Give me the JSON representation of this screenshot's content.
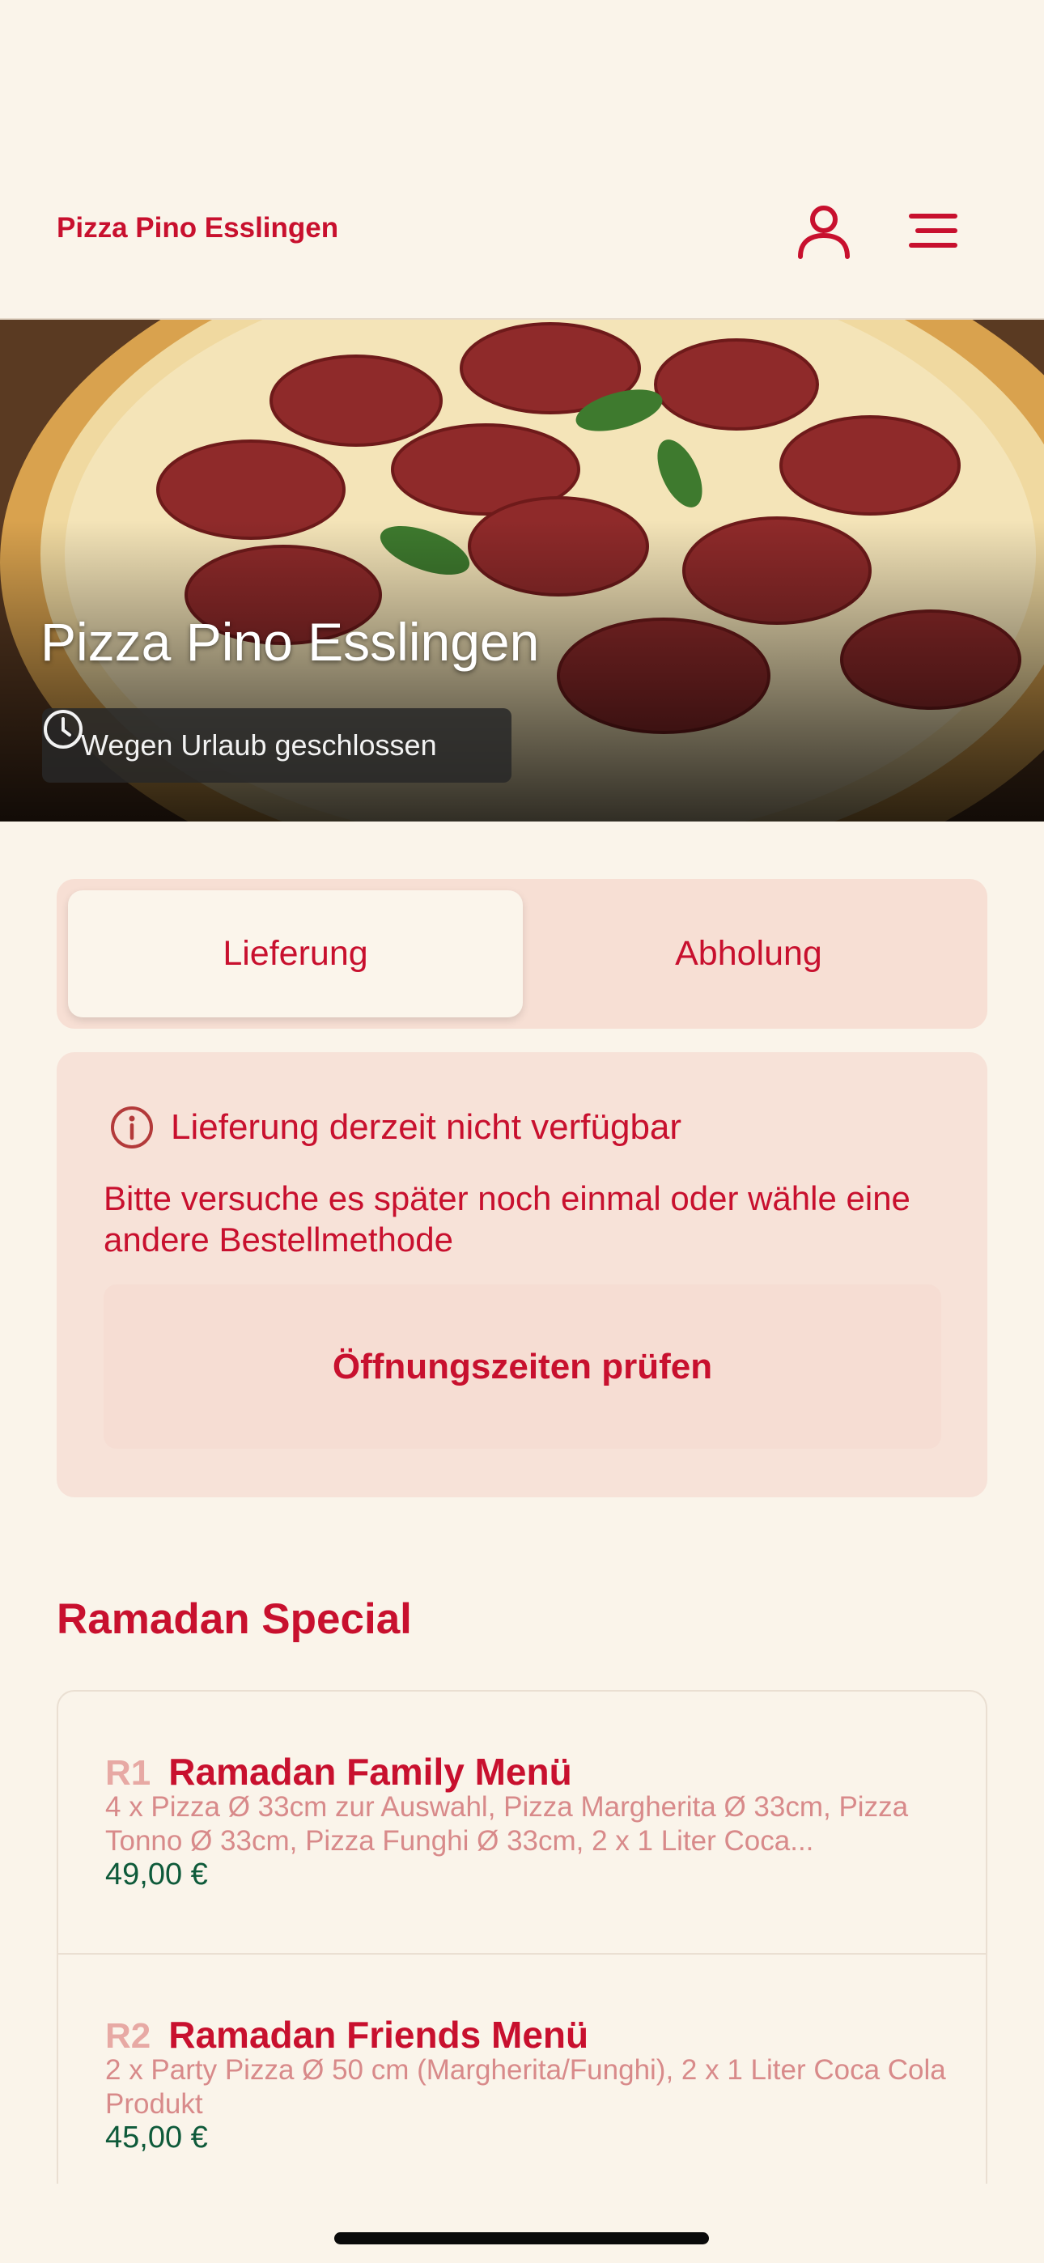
{
  "header": {
    "brand": "Pizza Pino Esslingen",
    "user_icon": "user-icon",
    "menu_icon": "hamburger-menu-icon"
  },
  "hero": {
    "title": "Pizza Pino Esslingen",
    "status_icon": "clock-icon",
    "status_text": "Wegen Urlaub geschlossen"
  },
  "order_mode": {
    "options": [
      "Lieferung",
      "Abholung"
    ],
    "selected": "Lieferung"
  },
  "notice": {
    "icon": "info-icon",
    "title": "Lieferung derzeit nicht verfügbar",
    "body": "Bitte versuche es später noch einmal oder wähle eine andere Bestellmethode",
    "button": "Öffnungszeiten prüfen"
  },
  "section": {
    "title": "Ramadan Special",
    "items": [
      {
        "code": "R1",
        "name": "Ramadan Family Menü",
        "description": "4 x Pizza Ø 33cm zur Auswahl, Pizza Margherita Ø 33cm, Pizza Tonno Ø 33cm, Pizza Funghi Ø 33cm, 2 x 1 Liter Coca...",
        "price": "49,00 €"
      },
      {
        "code": "R2",
        "name": "Ramadan Friends Menü",
        "description": "2 x Party Pizza Ø 50 cm (Margherita/Funghi),  2 x 1 Liter Coca Cola Produkt",
        "price": "45,00 €"
      }
    ]
  },
  "colors": {
    "background": "#FAF4EA",
    "accent": "#C8102E",
    "price": "#0E5A3A",
    "notice_bg": "#F7E2D8"
  }
}
